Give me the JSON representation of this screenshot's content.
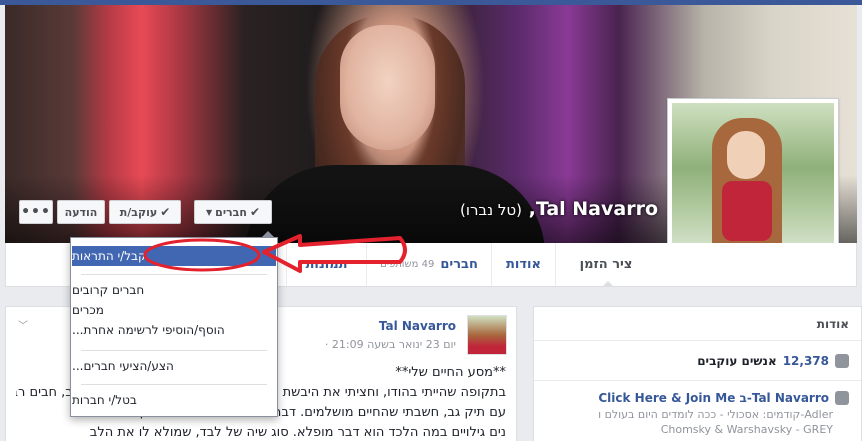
{
  "profile": {
    "name": "Tal Navarro",
    "alt_name": "(טל נברו)"
  },
  "actions": {
    "friends": "חברים",
    "following": "עוקב/ת",
    "message": "הודעה",
    "more": "•••"
  },
  "tabs": {
    "timeline": "ציר הזמן",
    "about": "אודות",
    "friends": "חברים",
    "friends_count": "49 משותפים",
    "photos": "תמונות"
  },
  "friend_menu": {
    "items": [
      "קבל/י התראות",
      "חברים קרובים",
      "מכרים",
      "הוסף/הוסיפי לרשימה אחרת...",
      "הצע/הציעי חברים...",
      "בטל/י חברות"
    ],
    "selected": 0
  },
  "about": {
    "title": "אודות",
    "followers_number": "12,378",
    "followers_label": "אנשים עוקבים",
    "work_line": "Click Here & Join Me ב-Tal Navarro",
    "work_sub1": "קודמים: אסכולי - ככה לומדים היום בעולם ו-Adler",
    "work_sub2": "Chomsky & Warshavsky - GREY"
  },
  "post": {
    "author": "Tal Navarro",
    "time": "יום 23 ינואר בשעה 21:09 ·",
    "line1": "**מסע החיים שלי**",
    "line2": "בתקופה שהייתי בהודו, וחציתי את היבשת מצפון לדרום עם תרמיל גב ועם תיק גב, חבים רבים",
    "line3": "עם תיק גב, חשבתי שהחיים מושלמים. דבר נשגב. הנאה בלתי פוסקת.",
    "line4": "נים גילויים במה הלכד הוא דבר מופלא. סוג שיה של לבד, שמולא לו את הלב"
  }
}
